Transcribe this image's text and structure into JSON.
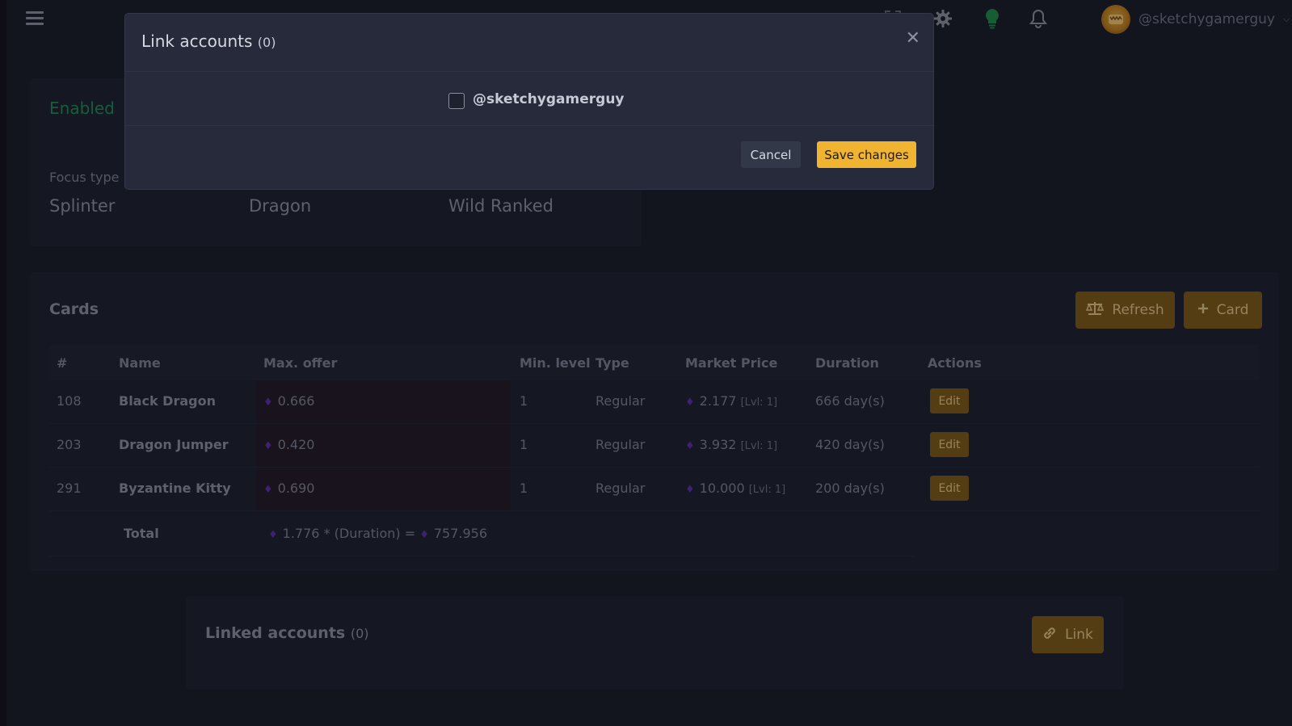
{
  "topbar": {
    "username": "@sketchygamerguy",
    "icons": [
      "menu-icon",
      "fullscreen-icon",
      "settings-gear-icon",
      "lightbulb-icon",
      "bell-icon"
    ]
  },
  "focus": {
    "status": "Enabled",
    "label": "Focus type",
    "values": [
      "Splinter",
      "Dragon",
      "Wild Ranked"
    ]
  },
  "cards": {
    "title": "Cards",
    "refresh_label": "Refresh",
    "add_card_label": "Card",
    "headers": [
      "#",
      "Name",
      "Max. offer",
      "Min. level",
      "Type",
      "Market Price",
      "Duration",
      "Actions"
    ],
    "rows": [
      {
        "id": "108",
        "name": "Black Dragon",
        "max_offer": "0.666",
        "min_level": "1",
        "type": "Regular",
        "market_price": "2.177",
        "lvl": "[Lvl: 1]",
        "duration": "666 day(s)",
        "action": "Edit"
      },
      {
        "id": "203",
        "name": "Dragon Jumper",
        "max_offer": "0.420",
        "min_level": "1",
        "type": "Regular",
        "market_price": "3.932",
        "lvl": "[Lvl: 1]",
        "duration": "420 day(s)",
        "action": "Edit"
      },
      {
        "id": "291",
        "name": "Byzantine Kitty",
        "max_offer": "0.690",
        "min_level": "1",
        "type": "Regular",
        "market_price": "10.000",
        "lvl": "[Lvl: 1]",
        "duration": "200 day(s)",
        "action": "Edit"
      }
    ],
    "total": {
      "label": "Total",
      "sum": "1.776",
      "formula_text": "* (Duration) =",
      "result": "757.956"
    }
  },
  "linked": {
    "title": "Linked accounts",
    "count": "(0)",
    "link_label": "Link"
  },
  "modal": {
    "title": "Link accounts",
    "count": "(0)",
    "option_label": "@sketchygamerguy",
    "option_checked": false,
    "cancel_label": "Cancel",
    "save_label": "Save changes"
  },
  "colors": {
    "accent_gold": "#f1b430",
    "button_gold_dark": "#7d5a14",
    "enabled_green": "#1f8a50",
    "diamond_purple": "#5a2ea8"
  }
}
